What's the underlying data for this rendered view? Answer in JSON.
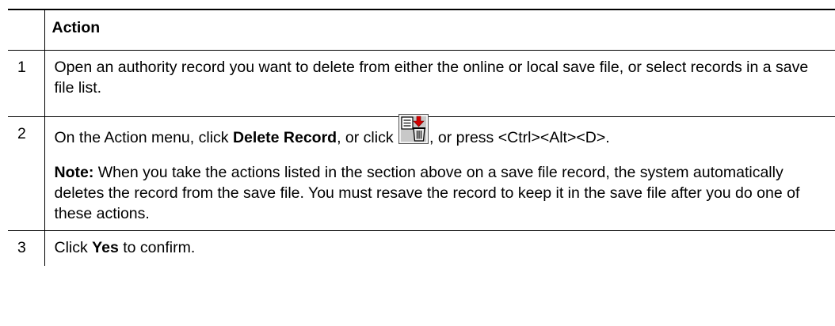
{
  "table": {
    "header": {
      "number": "",
      "action": "Action"
    },
    "steps": [
      {
        "number": "1",
        "text": "Open an authority record you want to delete from either the online or local save file, or select records in a save file list."
      },
      {
        "number": "2",
        "instruction": {
          "prefix": "On the Action menu, click ",
          "bold": "Delete Record",
          "middle": ", or click ",
          "icon": "delete-record-icon",
          "suffix": ", or press <Ctrl><Alt><D>."
        },
        "note": {
          "label": "Note:",
          "text": " When you take the actions listed in the section above on a save file record, the system automatically deletes the record from the save file. You must resave the record to keep it in the save file after you do one of these actions."
        }
      },
      {
        "number": "3",
        "prefix": "Click ",
        "bold": "Yes",
        "suffix": " to confirm."
      }
    ]
  }
}
